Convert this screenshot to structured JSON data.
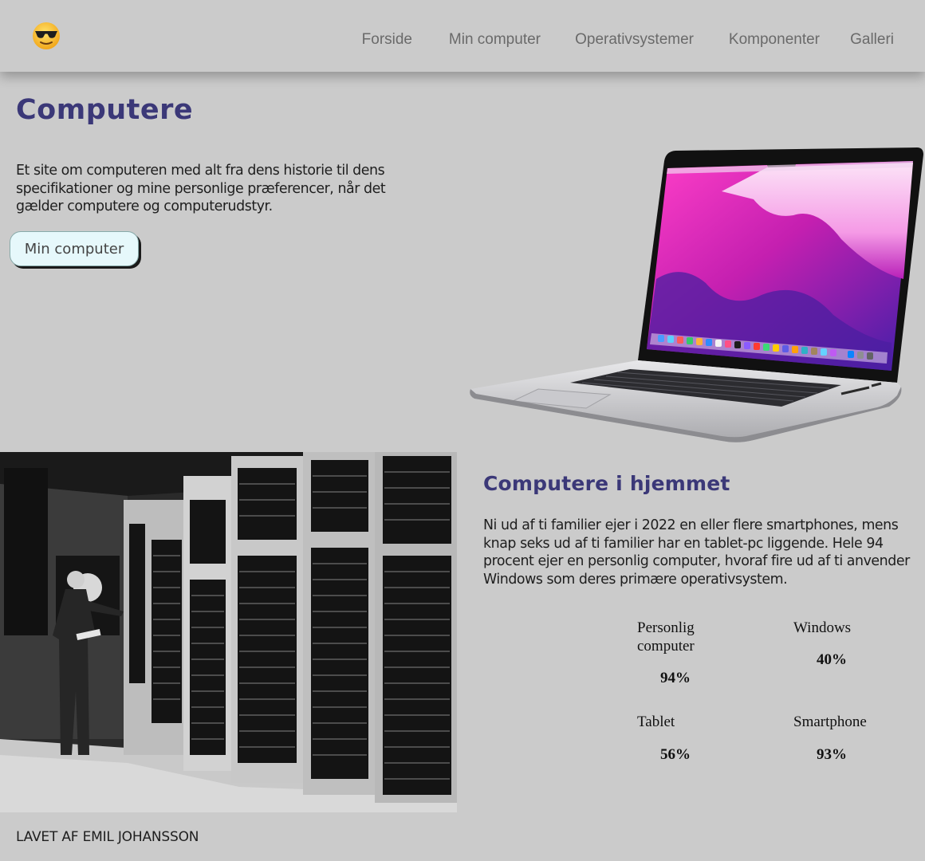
{
  "header": {
    "logo_icon": "sunglasses-emoji-icon",
    "nav": [
      {
        "label": "Forside"
      },
      {
        "label": "Min computer"
      },
      {
        "label": "Operativsystemer"
      },
      {
        "label": "Komponenter"
      },
      {
        "label": "Galleri"
      }
    ]
  },
  "hero": {
    "title": "Computere",
    "text": "Et site om computeren med alt fra dens historie til dens specifikationer og mine personlige præferencer, når det gælder computere og computerudstyr.",
    "button_label": "Min computer"
  },
  "section": {
    "title": "Computere i hjemmet",
    "text": "Ni ud af ti familier ejer i 2022 en eller flere smartphones, mens knap seks ud af ti familier har en tablet-pc liggende. Hele 94 procent ejer en personlig computer, hvoraf fire ud af ti anvender Windows som deres primære operativsystem.",
    "stats": [
      {
        "label": "Personlig computer",
        "value": "94%"
      },
      {
        "label": "Windows",
        "value": "40%"
      },
      {
        "label": "Tablet",
        "value": "56%"
      },
      {
        "label": "Smartphone",
        "value": "93%"
      }
    ]
  },
  "footer": {
    "text": "LAVET AF EMIL JOHANSSON"
  },
  "colors": {
    "background": "#cbcbcb",
    "heading": "#3b3878",
    "button_bg": "#e6f8fb"
  }
}
